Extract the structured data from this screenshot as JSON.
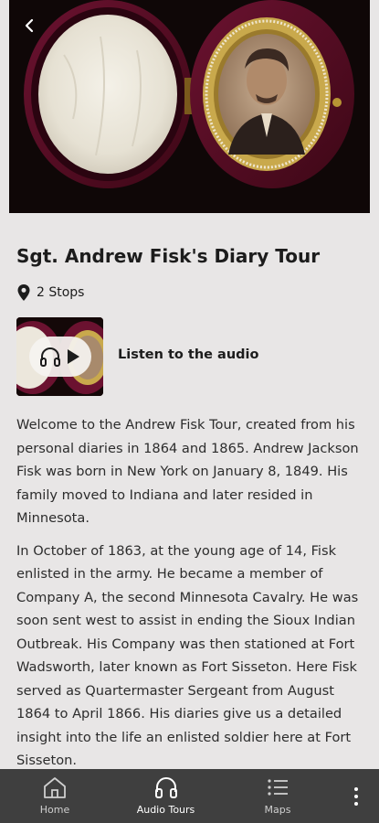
{
  "tour": {
    "title": "Sgt. Andrew Fisk's Diary Tour",
    "stops_label": "2 Stops"
  },
  "audio": {
    "label": "Listen to the audio"
  },
  "description": [
    "Welcome to the Andrew Fisk Tour, created from his personal diaries in 1864 and 1865. Andrew Jackson Fisk was born in New York on January 8, 1849. His family moved to Indiana and later resided in Minnesota.",
    "In October of 1863, at the young age of 14, Fisk enlisted in the army. He became a member of Company A, the second Minnesota Cavalry. He was soon sent west to assist in ending the Sioux Indian Outbreak. His Company was then stationed at Fort Wadsworth, later known as Fort Sisseton. Here Fisk served as Quartermaster Sergeant from August 1864 to April 1866. His diaries give us a detailed insight into the life an enlisted soldier here at Fort Sisseton."
  ],
  "nav": {
    "items": [
      {
        "label": "Home",
        "icon": "home-icon",
        "active": false
      },
      {
        "label": "Audio Tours",
        "icon": "headphones-icon",
        "active": true
      },
      {
        "label": "Maps",
        "icon": "list-icon",
        "active": false
      }
    ],
    "more_icon": "more-vertical-icon"
  },
  "colors": {
    "background": "#e8e6e6",
    "nav_background": "#3f3f3f",
    "text": "#1c1c1c"
  }
}
